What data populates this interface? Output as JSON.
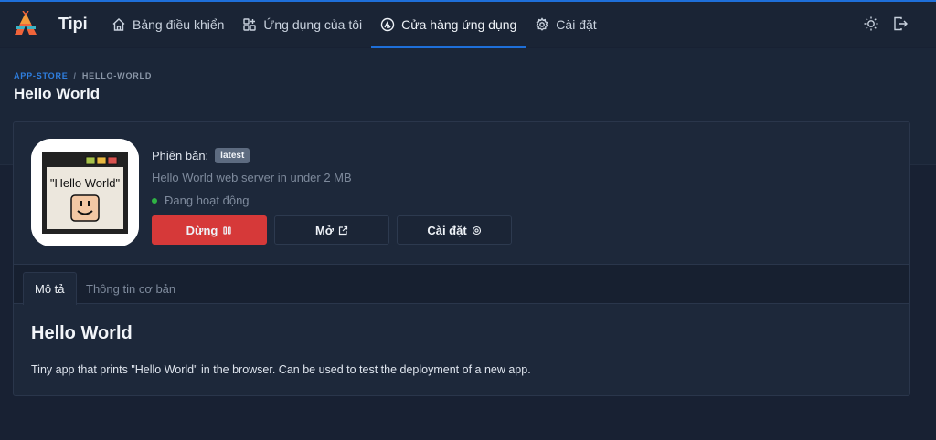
{
  "brand": {
    "name": "Tipi"
  },
  "nav": {
    "items": [
      {
        "label": "Bảng điều khiển",
        "icon": "home-icon"
      },
      {
        "label": "Ứng dụng của tôi",
        "icon": "apps-icon"
      },
      {
        "label": "Cửa hàng ứng dụng",
        "icon": "app-store-icon",
        "active": true
      },
      {
        "label": "Cài đặt",
        "icon": "gear-icon"
      }
    ]
  },
  "breadcrumb": {
    "root": "APP-STORE",
    "separator": "/",
    "current": "HELLO-WORLD"
  },
  "page": {
    "title": "Hello World"
  },
  "app": {
    "version_label": "Phiên bản:",
    "version": "latest",
    "description": "Hello World web server in under 2 MB",
    "status": "Đang hoạt động",
    "icon_text": "\"Hello World\""
  },
  "actions": {
    "stop": "Dừng",
    "open": "Mở",
    "settings": "Cài đặt"
  },
  "tabs": {
    "description": "Mô tả",
    "info": "Thông tin cơ bản"
  },
  "content": {
    "title": "Hello World",
    "body": "Tiny app that prints \"Hello World\" in the browser. Can be used to test the deployment of a new app."
  },
  "colors": {
    "accent": "#1e6fd9",
    "danger": "#d63939",
    "success": "#2fb344",
    "background": "#182133"
  }
}
